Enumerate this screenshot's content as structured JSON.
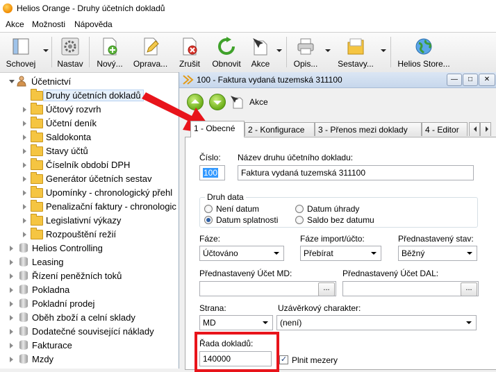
{
  "window": {
    "title": "Helios Orange - Druhy účetních dokladů"
  },
  "menu": [
    "Akce",
    "Možnosti",
    "Nápověda"
  ],
  "toolbar": {
    "schovej": "Schovej",
    "nastav": "Nastav",
    "novy": "Nový...",
    "oprava": "Oprava...",
    "zrusit": "Zrušit",
    "obnovit": "Obnovit",
    "akce": "Akce",
    "opis": "Opis...",
    "sestavy": "Sestavy...",
    "store": "Helios Store..."
  },
  "tree": {
    "root": "Účetnictví",
    "children": [
      "Druhy účetních dokladů",
      "Účtový rozvrh",
      "Účetní deník",
      "Saldokonta",
      "Stavy účtů",
      "Číselník období DPH",
      "Generátor účetních sestav",
      "Upomínky - chronologický přehl",
      "Penalizační faktury - chronologic",
      "Legislativní výkazy",
      "Rozpouštění režií"
    ],
    "modules": [
      "Helios Controlling",
      "Leasing",
      "Řízení peněžních toků",
      "Pokladna",
      "Pokladní prodej",
      "Oběh zboží a celní sklady",
      "Dodatečné související náklady",
      "Fakturace",
      "Mzdy"
    ]
  },
  "child": {
    "title": "100 - Faktura vydaná tuzemská 311100",
    "akce": "Akce",
    "tabs": [
      "1 - Obecné",
      "2 - Konfigurace",
      "3 - Přenos mezi doklady",
      "4 - Editor"
    ],
    "form": {
      "cislo_label": "Číslo:",
      "cislo_value": "100",
      "nazev_label": "Název druhu účetního dokladu:",
      "nazev_value": "Faktura vydaná tuzemská 311100",
      "druh_data_label": "Druh data",
      "radio_neni_datum": "Není datum",
      "radio_datum_uhrady": "Datum úhrady",
      "radio_datum_splatnosti": "Datum splatnosti",
      "radio_saldo": "Saldo bez datumu",
      "faze_label": "Fáze:",
      "faze_value": "Účtováno",
      "faze_import_label": "Fáze import/účto:",
      "faze_import_value": "Přebírat",
      "stav_label": "Přednastavený stav:",
      "stav_value": "Běžný",
      "ucet_md_label": "Přednastavený Účet MD:",
      "ucet_md_value": "",
      "ucet_dal_label": "Přednastavený Účet DAL:",
      "ucet_dal_value": "",
      "strana_label": "Strana:",
      "strana_value": "MD",
      "uzaverkovy_label": "Uzávěrkový charakter:",
      "uzaverkovy_value": "(není)",
      "rada_label": "Řada dokladů:",
      "rada_value": "140000",
      "plnit_label": "Plnit mezery",
      "ellipsis": "..."
    }
  },
  "colors": {
    "highlight": "#e8141b",
    "selection": "#3399ff"
  },
  "icons": [
    "helios-logo-icon",
    "schovej-icon",
    "nastav-gear-icon",
    "new-document-icon",
    "edit-document-icon",
    "delete-document-icon",
    "refresh-icon",
    "akce-icon",
    "printer-icon",
    "folder-icon",
    "globe-icon",
    "arrow-annotation-icon"
  ]
}
